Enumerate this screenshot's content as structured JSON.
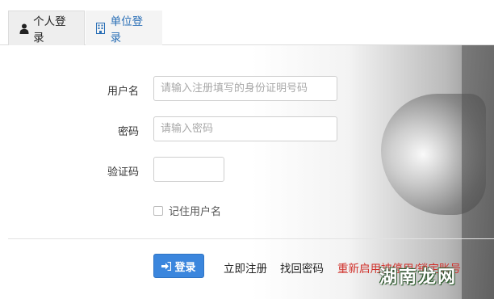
{
  "tabs": [
    {
      "label": "个人登录",
      "icon": "user-icon",
      "active": true
    },
    {
      "label": "单位登录",
      "icon": "building-icon",
      "active": false
    }
  ],
  "form": {
    "username": {
      "label": "用户名",
      "placeholder": "请输入注册填写的身份证明号码",
      "value": ""
    },
    "password": {
      "label": "密码",
      "placeholder": "请输入密码",
      "value": ""
    },
    "captcha": {
      "label": "验证码",
      "value": ""
    },
    "remember": {
      "label": "记住用户名",
      "checked": false
    }
  },
  "actions": {
    "login": {
      "label": "登录",
      "icon": "sign-in-icon"
    },
    "register": "立即注册",
    "recover": "找回密码",
    "reactivate": "重新启用被停用/锁定账号"
  },
  "watermark": "湖南龙网",
  "colors": {
    "primary": "#3b86dd",
    "tab_link": "#2a6fb6",
    "warning_link": "#d0302a"
  }
}
